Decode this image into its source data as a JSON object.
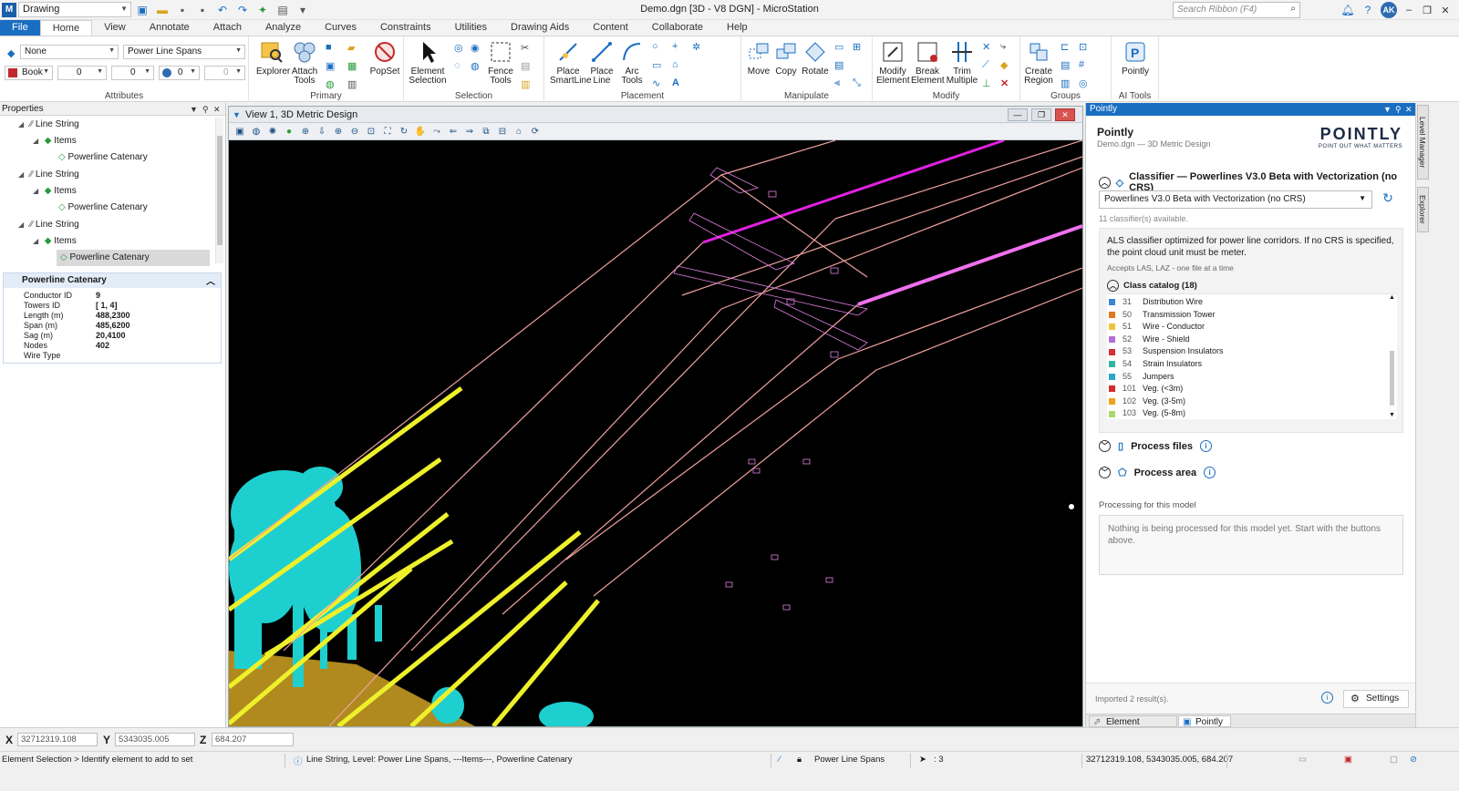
{
  "app": {
    "workflow": "Drawing",
    "window_title": "Demo.dgn [3D - V8 DGN] - MicroStation",
    "search_placeholder": "Search Ribbon (F4)",
    "user_initials": "AK"
  },
  "tabs": [
    "File",
    "Home",
    "View",
    "Annotate",
    "Attach",
    "Analyze",
    "Curves",
    "Constraints",
    "Utilities",
    "Drawing Aids",
    "Content",
    "Collaborate",
    "Help"
  ],
  "active_tab": "Home",
  "ribbon": {
    "attributes": {
      "label": "Attributes",
      "level_none": "None",
      "level": "Power Line Spans",
      "color": "Book",
      "weight": "0",
      "style": "0",
      "transparency": "0",
      "priority": "0"
    },
    "primary": {
      "label": "Primary",
      "explorer": "Explorer",
      "attach_tools_1": "Attach",
      "attach_tools_2": "Tools",
      "popset": "PopSet"
    },
    "selection": {
      "label": "Selection",
      "element_1": "Element",
      "element_2": "Selection",
      "fence_1": "Fence",
      "fence_2": "Tools"
    },
    "placement": {
      "label": "Placement",
      "smartline_1": "Place",
      "smartline_2": "SmartLine",
      "line_1": "Place",
      "line_2": "Line",
      "arc_1": "Arc",
      "arc_2": "Tools"
    },
    "manipulate": {
      "label": "Manipulate",
      "move": "Move",
      "copy": "Copy",
      "rotate": "Rotate"
    },
    "modify": {
      "label": "Modify",
      "modify_1": "Modify",
      "modify_2": "Element",
      "break_1": "Break",
      "break_2": "Element",
      "trim_1": "Trim",
      "trim_2": "Multiple"
    },
    "groups": {
      "label": "Groups",
      "region_1": "Create",
      "region_2": "Region"
    },
    "ai": {
      "label": "AI Tools",
      "pointly": "Pointly"
    }
  },
  "properties": {
    "title": "Properties",
    "tree": [
      {
        "label": "Line String",
        "level": 0
      },
      {
        "label": "Items",
        "level": 1
      },
      {
        "label": "Powerline Catenary",
        "level": 2
      },
      {
        "label": "Line String",
        "level": 0
      },
      {
        "label": "Items",
        "level": 1
      },
      {
        "label": "Powerline Catenary",
        "level": 2
      },
      {
        "label": "Line String",
        "level": 0
      },
      {
        "label": "Items",
        "level": 1
      },
      {
        "label": "Powerline Catenary",
        "level": 2
      }
    ],
    "card_title": "Powerline Catenary",
    "fields": [
      {
        "k": "Conductor ID",
        "v": "9"
      },
      {
        "k": "Towers ID",
        "v": "[  1,  4]"
      },
      {
        "k": "Length (m)",
        "v": "488,2300"
      },
      {
        "k": "Span (m)",
        "v": "485,6200"
      },
      {
        "k": "Sag (m)",
        "v": "20,4100"
      },
      {
        "k": "Nodes",
        "v": "402"
      },
      {
        "k": "Wire Type",
        "v": ""
      }
    ]
  },
  "view": {
    "title": "View 1, 3D Metric Design"
  },
  "pointly": {
    "panel_title": "Pointly",
    "title": "Pointly",
    "subtitle": "Demo.dgn — 3D Metric Design",
    "logo_main": "POINTLY",
    "logo_tag": "POINT OUT WHAT MATTERS",
    "classifier_head": "Classifier — Powerlines V3.0 Beta with Vectorization (no CRS)",
    "classifier_selected": "Powerlines V3.0 Beta with Vectorization (no CRS)",
    "classifier_count": "11 classifier(s) available.",
    "description": "ALS classifier optimized for power line corridors. If no CRS is specified, the point cloud unit must be meter.",
    "accepts": "Accepts LAS, LAZ - one file at a time",
    "catalog_head": "Class catalog (18)",
    "classes": [
      {
        "code": "31",
        "name": "Distribution Wire",
        "color": "#3f86d6"
      },
      {
        "code": "50",
        "name": "Transmission Tower",
        "color": "#e0781e"
      },
      {
        "code": "51",
        "name": "Wire - Conductor",
        "color": "#efc33a"
      },
      {
        "code": "52",
        "name": "Wire - Shield",
        "color": "#b56ed8"
      },
      {
        "code": "53",
        "name": "Suspension Insulators",
        "color": "#d43036"
      },
      {
        "code": "54",
        "name": "Strain Insulators",
        "color": "#2fb6a0"
      },
      {
        "code": "55",
        "name": "Jumpers",
        "color": "#2aa7c9"
      },
      {
        "code": "101",
        "name": "Veg. (<3m)",
        "color": "#d62b2b"
      },
      {
        "code": "102",
        "name": "Veg. (3-5m)",
        "color": "#f0a21c"
      },
      {
        "code": "103",
        "name": "Veg. (5-8m)",
        "color": "#a9d96a"
      }
    ],
    "process_files": "Process files",
    "process_area": "Process area",
    "processing_label": "Processing for this model",
    "processing_text": "Nothing is being processed for this model yet. Start with the buttons above.",
    "imported": "Imported 2 result(s).",
    "settings": "Settings",
    "bottom_tab_1": "Element Selection",
    "bottom_tab_2": "Pointly"
  },
  "side_tabs": [
    "Level Manager",
    "Explorer"
  ],
  "coords": {
    "x_label": "X",
    "x": "32712319.108",
    "y_label": "Y",
    "y": "5343035.005",
    "z_label": "Z",
    "z": "684.207"
  },
  "status": {
    "prompt": "Element Selection > Identify element to add to set",
    "message": "Line String, Level: Power Line Spans, ---Items---, Powerline Catenary",
    "level": "Power Line Spans",
    "count": ": 3",
    "position": "32712319.108, 5343035.005, 684.207"
  },
  "colors": {
    "accent": "#1a6ec2",
    "shield_wire": "#e020e0",
    "conductor": "#f0a0a0",
    "vegetation": "#1ad0d0",
    "ground": "#b58a1e",
    "point_yellow": "#eef02a"
  }
}
